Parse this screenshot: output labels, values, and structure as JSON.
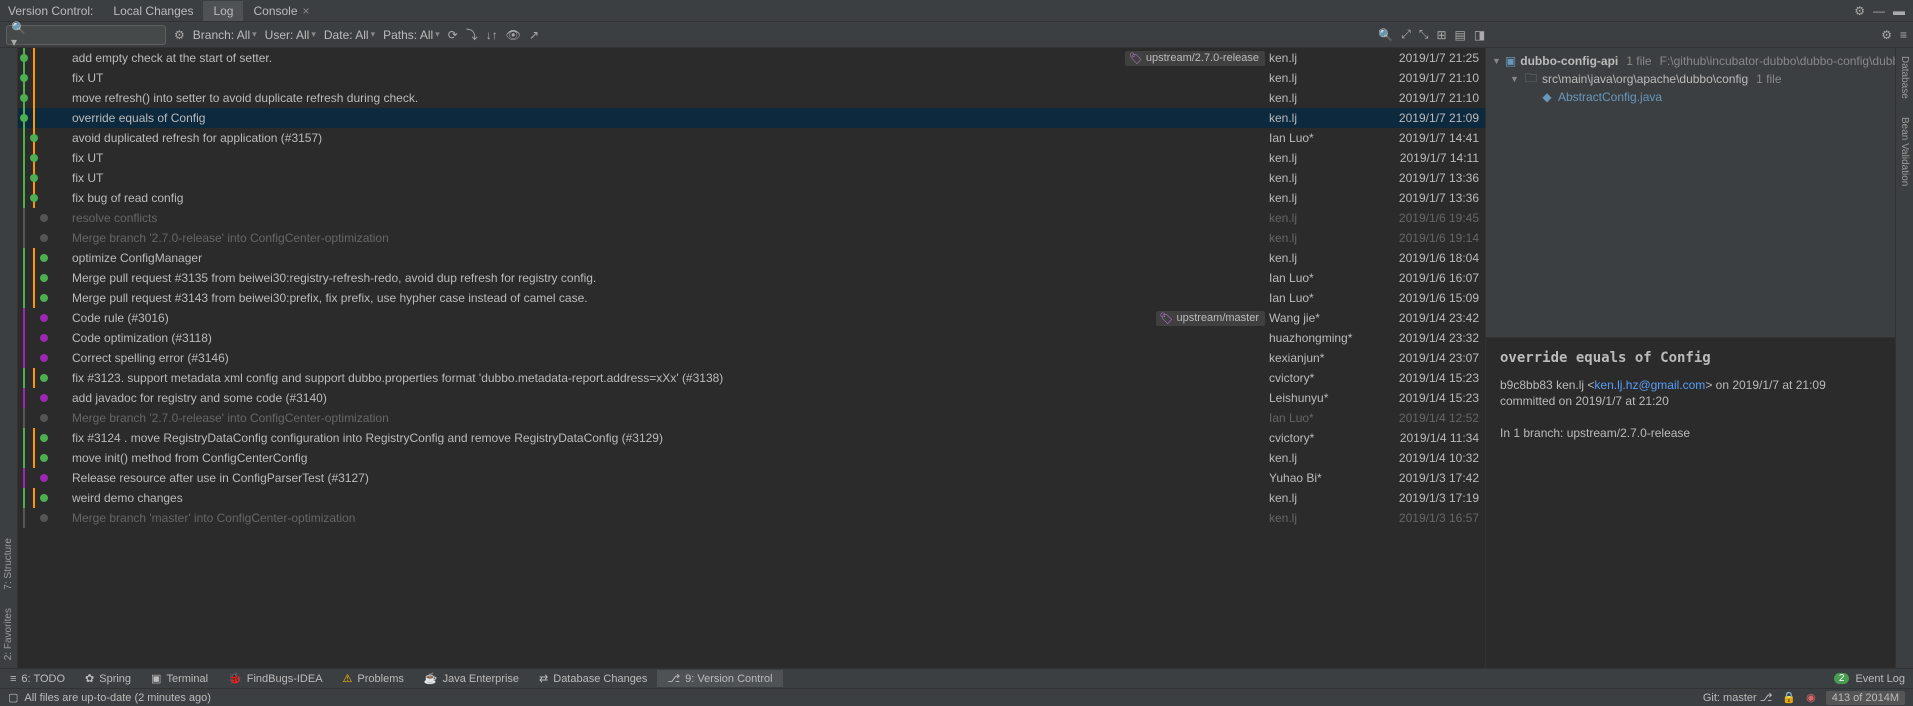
{
  "topTabs": {
    "label": "Version Control:",
    "items": [
      "Local Changes",
      "Log",
      "Console"
    ],
    "active": 1
  },
  "filters": {
    "branch": "Branch: All",
    "user": "User: All",
    "date": "Date: All",
    "paths": "Paths: All"
  },
  "commits": [
    {
      "msg": "add empty check at the start of setter.",
      "author": "ken.lj",
      "date": "2019/1/7 21:25",
      "tag": "upstream/2.7.0-release",
      "dim": false,
      "sel": false,
      "graphX": 2,
      "colors": [
        "#4caf50",
        "#ff9800"
      ]
    },
    {
      "msg": "fix UT",
      "author": "ken.lj",
      "date": "2019/1/7 21:10",
      "dim": false,
      "sel": false,
      "graphX": 2,
      "colors": [
        "#4caf50",
        "#ff9800"
      ]
    },
    {
      "msg": "move refresh() into setter to avoid duplicate refresh during check.",
      "author": "ken.lj",
      "date": "2019/1/7 21:10",
      "dim": false,
      "sel": false,
      "graphX": 2,
      "colors": [
        "#4caf50",
        "#ff9800"
      ]
    },
    {
      "msg": "override equals of Config",
      "author": "ken.lj",
      "date": "2019/1/7 21:09",
      "dim": false,
      "sel": true,
      "graphX": 2,
      "colors": [
        "#4caf50",
        "#ff9800"
      ]
    },
    {
      "msg": "avoid duplicated refresh for application (#3157)",
      "author": "Ian Luo*",
      "date": "2019/1/7 14:41",
      "dim": false,
      "sel": false,
      "graphX": 3,
      "colors": [
        "#4caf50",
        "#ff9800"
      ]
    },
    {
      "msg": "fix UT",
      "author": "ken.lj",
      "date": "2019/1/7 14:11",
      "dim": false,
      "sel": false,
      "graphX": 3,
      "colors": [
        "#4caf50",
        "#ff9800"
      ]
    },
    {
      "msg": "fix UT",
      "author": "ken.lj",
      "date": "2019/1/7 13:36",
      "dim": false,
      "sel": false,
      "graphX": 3,
      "colors": [
        "#4caf50",
        "#ff9800"
      ]
    },
    {
      "msg": "fix bug of read config",
      "author": "ken.lj",
      "date": "2019/1/7 13:36",
      "dim": false,
      "sel": false,
      "graphX": 3,
      "colors": [
        "#4caf50",
        "#ff9800"
      ]
    },
    {
      "msg": "resolve conflicts",
      "author": "ken.lj",
      "date": "2019/1/6 19:45",
      "dim": true,
      "sel": false,
      "graphX": 4,
      "colors": [
        "#aaa"
      ]
    },
    {
      "msg": "Merge branch '2.7.0-release' into ConfigCenter-optimization",
      "author": "ken.lj",
      "date": "2019/1/6 19:14",
      "dim": true,
      "sel": false,
      "graphX": 4,
      "colors": [
        "#aaa"
      ]
    },
    {
      "msg": "optimize ConfigManager",
      "author": "ken.lj",
      "date": "2019/1/6 18:04",
      "dim": false,
      "sel": false,
      "graphX": 4,
      "colors": [
        "#4caf50",
        "#ff9800"
      ]
    },
    {
      "msg": "Merge pull request #3135 from beiwei30:registry-refresh-redo, avoid dup refresh for registry config.",
      "author": "Ian Luo*",
      "date": "2019/1/6 16:07",
      "dim": false,
      "sel": false,
      "graphX": 4,
      "colors": [
        "#4caf50",
        "#ff9800"
      ]
    },
    {
      "msg": "Merge pull request #3143 from beiwei30:prefix, fix prefix, use hypher case instead of camel case.",
      "author": "Ian Luo*",
      "date": "2019/1/6 15:09",
      "dim": false,
      "sel": false,
      "graphX": 4,
      "colors": [
        "#4caf50",
        "#ff9800"
      ]
    },
    {
      "msg": "Code rule (#3016)",
      "author": "Wang jie*",
      "date": "2019/1/4 23:42",
      "tag": "upstream/master",
      "dim": false,
      "sel": false,
      "graphX": 4,
      "colors": [
        "#9c27b0"
      ]
    },
    {
      "msg": "Code optimization (#3118)",
      "author": "huazhongming*",
      "date": "2019/1/4 23:32",
      "dim": false,
      "sel": false,
      "graphX": 4,
      "colors": [
        "#9c27b0"
      ]
    },
    {
      "msg": "Correct spelling error (#3146)",
      "author": "kexianjun*",
      "date": "2019/1/4 23:07",
      "dim": false,
      "sel": false,
      "graphX": 4,
      "colors": [
        "#9c27b0"
      ]
    },
    {
      "msg": "fix #3123.  support metadata xml config and support dubbo.properties format 'dubbo.metadata-report.address=xXx' (#3138)",
      "author": "cvictory*",
      "date": "2019/1/4 15:23",
      "dim": false,
      "sel": false,
      "graphX": 4,
      "colors": [
        "#4caf50",
        "#ff9800"
      ]
    },
    {
      "msg": "add javadoc for registry and some code (#3140)",
      "author": "Leishunyu*",
      "date": "2019/1/4 15:23",
      "dim": false,
      "sel": false,
      "graphX": 4,
      "colors": [
        "#9c27b0"
      ]
    },
    {
      "msg": "Merge branch '2.7.0-release' into ConfigCenter-optimization",
      "author": "Ian Luo*",
      "date": "2019/1/4 12:52",
      "dim": true,
      "sel": false,
      "graphX": 4,
      "colors": [
        "#aaa"
      ]
    },
    {
      "msg": "fix #3124 . move RegistryDataConfig configuration into RegistryConfig and remove RegistryDataConfig (#3129)",
      "author": "cvictory*",
      "date": "2019/1/4 11:34",
      "dim": false,
      "sel": false,
      "graphX": 4,
      "colors": [
        "#4caf50",
        "#ff9800"
      ]
    },
    {
      "msg": "move init() method from ConfigCenterConfig",
      "author": "ken.lj",
      "date": "2019/1/4 10:32",
      "dim": false,
      "sel": false,
      "graphX": 4,
      "colors": [
        "#4caf50",
        "#ff9800"
      ]
    },
    {
      "msg": "Release resource after use in ConfigParserTest (#3127)",
      "author": "Yuhao Bi*",
      "date": "2019/1/3 17:42",
      "dim": false,
      "sel": false,
      "graphX": 4,
      "colors": [
        "#9c27b0"
      ]
    },
    {
      "msg": "weird demo changes",
      "author": "ken.lj",
      "date": "2019/1/3 17:19",
      "dim": false,
      "sel": false,
      "graphX": 4,
      "colors": [
        "#4caf50",
        "#ff9800"
      ]
    },
    {
      "msg": "Merge branch 'master' into ConfigCenter-optimization",
      "author": "ken.lj",
      "date": "2019/1/3 16:57",
      "dim": true,
      "sel": false,
      "graphX": 4,
      "colors": [
        "#aaa"
      ]
    }
  ],
  "tree": {
    "root": {
      "name": "dubbo-config-api",
      "count": "1 file",
      "path": "F:\\github\\incubator-dubbo\\dubbo-config\\dubbo-config-api"
    },
    "folder": {
      "name": "src\\main\\java\\org\\apache\\dubbo\\config",
      "count": "1 file"
    },
    "file": "AbstractConfig.java"
  },
  "detail": {
    "title": "override equals of Config",
    "hash": "b9c8bb83",
    "author": "ken.lj",
    "email": "ken.lj.hz@gmail.com",
    "dateLine": "on 2019/1/7 at 21:09",
    "committedLine": "committed on 2019/1/7 at 21:20",
    "branchLine": "In 1 branch: upstream/2.7.0-release"
  },
  "bottomTabs": {
    "items": [
      {
        "label": "6: TODO",
        "icon": "≡"
      },
      {
        "label": "Spring",
        "icon": "✿"
      },
      {
        "label": "Terminal",
        "icon": "▣"
      },
      {
        "label": "FindBugs-IDEA",
        "icon": "🐞"
      },
      {
        "label": "Problems",
        "icon": "⚠"
      },
      {
        "label": "Java Enterprise",
        "icon": "☕"
      },
      {
        "label": "Database Changes",
        "icon": "⇄"
      },
      {
        "label": "9: Version Control",
        "icon": "⎇"
      }
    ],
    "active": 7,
    "eventLog": "Event Log",
    "eventCount": "2"
  },
  "statusBar": {
    "msg": "All files are up-to-date (2 minutes ago)",
    "git": "Git: master",
    "mem": "413 of 2014M"
  },
  "leftGutter": [
    "7: Structure",
    "2: Favorites"
  ],
  "rightGutter": [
    "Database",
    "Bean Validation"
  ]
}
